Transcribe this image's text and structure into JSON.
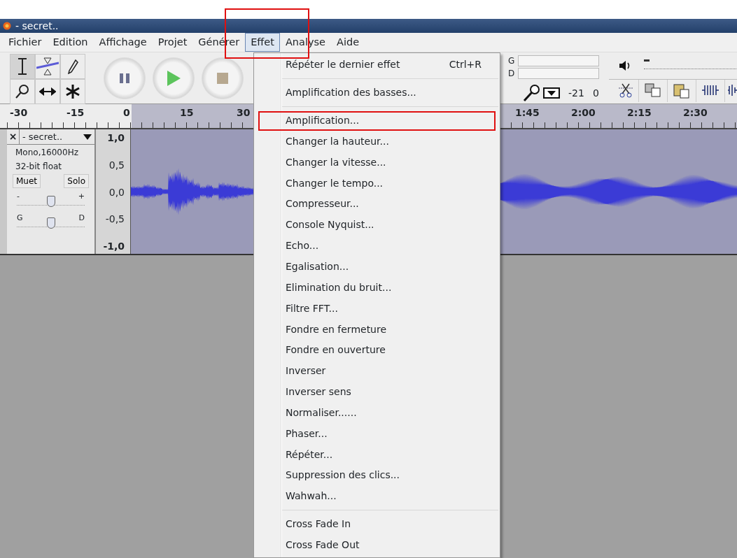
{
  "window": {
    "title": "- secret.."
  },
  "menubar": [
    {
      "label": "Fichier",
      "selected": false
    },
    {
      "label": "Edition",
      "selected": false
    },
    {
      "label": "Affichage",
      "selected": false
    },
    {
      "label": "Projet",
      "selected": false
    },
    {
      "label": "Générer",
      "selected": false
    },
    {
      "label": "Effet",
      "selected": true
    },
    {
      "label": "Analyse",
      "selected": false
    },
    {
      "label": "Aide",
      "selected": false
    }
  ],
  "volume": {
    "level": 0.03
  },
  "meter": {
    "left_label": "G",
    "right_label": "D",
    "scale_min": "-21",
    "scale_max": "0"
  },
  "ruler": {
    "left_labels": [
      "-30",
      "-15",
      "0",
      "15",
      "30"
    ],
    "right_labels": [
      "1:45",
      "2:00",
      "2:15",
      "2:30"
    ]
  },
  "track": {
    "name": "- secret..",
    "close": "×",
    "format": "Mono,16000Hz",
    "bits": "32-bit float",
    "buttons": [
      "Muet",
      "Solo"
    ],
    "gain": {
      "minus": "-",
      "plus": "+",
      "level": 0.5
    },
    "pan": {
      "left": "G",
      "right": "D",
      "level": 0.5
    },
    "scale": [
      "1,0",
      "0,5",
      "0,0",
      "-0,5",
      "-1,0"
    ]
  },
  "menu": {
    "items": [
      {
        "kind": "item",
        "label": "Répéter le dernier effet",
        "shortcut": "Ctrl+R",
        "annotated": false
      },
      {
        "kind": "separator"
      },
      {
        "kind": "item",
        "label": "Amplification des basses...",
        "annotated": false
      },
      {
        "kind": "separator"
      },
      {
        "kind": "item",
        "label": "Amplification...",
        "annotated": true
      },
      {
        "kind": "item",
        "label": "Changer la hauteur...",
        "annotated": false
      },
      {
        "kind": "item",
        "label": "Changer la vitesse...",
        "annotated": false
      },
      {
        "kind": "item",
        "label": "Changer le tempo...",
        "annotated": false
      },
      {
        "kind": "item",
        "label": "Compresseur...",
        "annotated": false
      },
      {
        "kind": "item",
        "label": "Console Nyquist...",
        "annotated": false
      },
      {
        "kind": "item",
        "label": "Echo...",
        "annotated": false
      },
      {
        "kind": "item",
        "label": "Egalisation...",
        "annotated": false
      },
      {
        "kind": "item",
        "label": "Elimination du bruit...",
        "annotated": false
      },
      {
        "kind": "item",
        "label": "Filtre FFT...",
        "annotated": false
      },
      {
        "kind": "item",
        "label": "Fondre en fermeture",
        "annotated": false
      },
      {
        "kind": "item",
        "label": "Fondre en ouverture",
        "annotated": false
      },
      {
        "kind": "item",
        "label": "Inverser",
        "annotated": false
      },
      {
        "kind": "item",
        "label": "Inverser sens",
        "annotated": false
      },
      {
        "kind": "item",
        "label": "Normaliser......",
        "annotated": false
      },
      {
        "kind": "item",
        "label": "Phaser...",
        "annotated": false
      },
      {
        "kind": "item",
        "label": "Répéter...",
        "annotated": false
      },
      {
        "kind": "item",
        "label": "Suppression des clics...",
        "annotated": false
      },
      {
        "kind": "item",
        "label": "Wahwah...",
        "annotated": false
      },
      {
        "kind": "separator"
      },
      {
        "kind": "item",
        "label": "Cross Fade In",
        "annotated": false
      },
      {
        "kind": "item",
        "label": "Cross Fade Out",
        "annotated": false
      }
    ]
  }
}
